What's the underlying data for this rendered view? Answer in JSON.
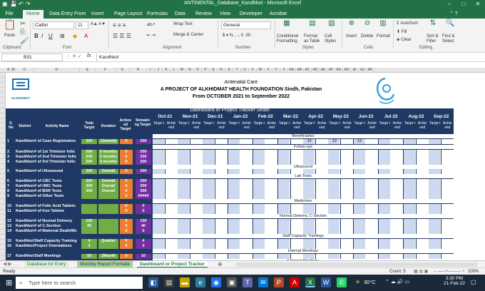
{
  "window": {
    "title": "ANTINENTAL_Database_Kandhkot  -  Microsoft Excel"
  },
  "tabs": [
    "File",
    "Home",
    "Data Entry From",
    "Insert",
    "Page Layout",
    "Formulas",
    "Data",
    "Review",
    "View",
    "Developer",
    "Acrobat"
  ],
  "ribbon": {
    "paste": "Paste",
    "font_name": "Calibri",
    "font_size": "11",
    "wrap_text": "Wrap Text",
    "merge_center": "Merge & Center",
    "number_format": "General",
    "conditional": "Conditional Formatting",
    "format_table": "Format as Table",
    "cell_styles": "Cell Styles",
    "insert": "Insert",
    "delete": "Delete",
    "format": "Format",
    "autosum": "AutoSum",
    "fill": "Fill",
    "clear": "Clear",
    "sort_filter": "Sort & Filter",
    "find_select": "Find & Select",
    "groups": {
      "clipboard": "Clipboard",
      "font": "Font",
      "alignment": "Alignment",
      "number": "Number",
      "styles": "Styles",
      "cells": "Cells",
      "editing": "Editing"
    }
  },
  "formula_bar": {
    "name_box": "B31",
    "fx": "fx",
    "content": "Kandhkot"
  },
  "columns": [
    "A",
    "B",
    "C",
    "D",
    "E",
    "F",
    "G",
    "H",
    "I",
    "J",
    "K",
    "L",
    "M",
    "N",
    "O",
    "P",
    "Q",
    "R",
    "S",
    "T",
    "U",
    "V",
    "W",
    "X",
    "Y",
    "Z",
    "AA",
    "AB",
    "AC",
    "AD",
    "AE",
    "AF",
    "AG",
    "AH",
    "AI",
    "AJ",
    "AK"
  ],
  "sheet": {
    "logo_text": "ALKHIDMAT",
    "title1": "Antenatal Care",
    "title2": "A PROJECT OF ALKHIDMAT HEALTH  FOUNDATION Sindh, Pakistan",
    "title3": "From OCTOBER 2021 to September 2022",
    "tracker": "Dashboard or Project Tracker Sindh",
    "col_headers": {
      "sno": "S. No",
      "district": "District",
      "activity": "Activity Name",
      "total": "Total Target",
      "duration": "Duration",
      "achieved": "Achiev ed Target",
      "remaining": "Remaini ng Target"
    },
    "months": [
      "Oct-21",
      "Nov-21",
      "Dec-21",
      "Jan-22",
      "Feb-22",
      "Mar-22",
      "Apr-22",
      "May-22",
      "Jun-22",
      "Jul-22",
      "Aug-22",
      "Sep-22"
    ],
    "sub_target": "Targe t",
    "sub_achieved": "Achie ved",
    "sections": {
      "beneficiaries": "Beneficiaries",
      "followups": "Follow ups",
      "ultrasound": "Ultrasound",
      "labtests": "Lab Tests",
      "medicines": "Medicines",
      "delivery": "Normal Delivery, C-Section",
      "trainings": "Staff Capacity Trainings",
      "internal": "Internal Meetings",
      "external": "External Meetings"
    },
    "rows": [
      {
        "sno": "1",
        "district": "Kandhkot",
        "activity": "# of Case Registration",
        "total": "300",
        "duration": "12month",
        "achieved": "0",
        "remaining": "300",
        "apr": "12",
        "may": "12",
        "jun": "12"
      },
      {
        "sno": "2",
        "district": "Kandhkot",
        "activity": "# of 1st Trimister follo",
        "total": "200",
        "duration": "3 months",
        "achieved": "0",
        "remaining": "200"
      },
      {
        "sno": "3",
        "district": "Kandhkot",
        "activity": "# of 2nd Trimister follo",
        "total": "200",
        "duration": "3 months",
        "achieved": "0",
        "remaining": "200"
      },
      {
        "sno": "4",
        "district": "Kandhkot",
        "activity": "# of 3rd Trimister follo",
        "total": "200",
        "duration": "3 months",
        "achieved": "0",
        "remaining": "200"
      },
      {
        "sno": "5",
        "district": "Kandhkot",
        "activity": "# of Ultrasound",
        "total": "300",
        "duration": "Overall",
        "achieved": "0",
        "remaining": "300"
      },
      {
        "sno": "6",
        "district": "Kandhkot",
        "activity": "# of CBC Tests",
        "total": "300",
        "duration": "Overall",
        "achieved": "0",
        "remaining": "300"
      },
      {
        "sno": "7",
        "district": "Kandhkot",
        "activity": "# of HBC Tests",
        "total": "300",
        "duration": "Overall",
        "achieved": "0",
        "remaining": "300"
      },
      {
        "sno": "8",
        "district": "Kandhkot",
        "activity": "# of BSR Tests",
        "total": "300",
        "duration": "Overall",
        "achieved": "0",
        "remaining": "300"
      },
      {
        "sno": "9",
        "district": "Kandhkot",
        "activity": "# of Other Tests",
        "total": "",
        "duration": "",
        "achieved": "0",
        "remaining": "#####"
      },
      {
        "sno": "10",
        "district": "Kandhkot",
        "activity": "# of Folic Acid Tablets",
        "total": "",
        "duration": "",
        "achieved": "0",
        "remaining": "0"
      },
      {
        "sno": "11",
        "district": "Kandhkot",
        "activity": "# of Iron Tablets",
        "total": "",
        "duration": "",
        "achieved": "0",
        "remaining": "0"
      },
      {
        "sno": "12",
        "district": "Kandhkot",
        "activity": "# of Normal Delivery",
        "total": "100",
        "duration": "",
        "achieved": "0",
        "remaining": "100"
      },
      {
        "sno": "13",
        "district": "Kandhkot",
        "activity": "# of C-Section",
        "total": "40",
        "duration": "",
        "achieved": "0",
        "remaining": "40"
      },
      {
        "sno": "14",
        "district": "Kandhkot",
        "activity": "# of Maternal Death/Mc",
        "total": "",
        "duration": "",
        "achieved": "0",
        "remaining": "0"
      },
      {
        "sno": "15",
        "district": "Kandhkot",
        "activity": "Staff Capacity Training",
        "total": "4",
        "duration": "Quarter",
        "achieved": "0",
        "remaining": "4"
      },
      {
        "sno": "16",
        "district": "Kandhkot",
        "activity": "Project Orientations",
        "total": "3",
        "duration": "",
        "achieved": "0",
        "remaining": "3"
      },
      {
        "sno": "17",
        "district": "Kandhkot",
        "activity": "Staff Meetings",
        "total": "10",
        "duration": "2Month",
        "achieved": "0",
        "remaining": "10"
      }
    ]
  },
  "sheet_tabs": [
    "Database for Entry",
    "Monthly Report Formate",
    "Dashboard or Project Tracker"
  ],
  "status": {
    "ready": "Ready",
    "count": "Count: 5",
    "zoom": "100%"
  },
  "taskbar": {
    "search": "Type here to search",
    "weather": "30°C",
    "time": "3:30 PM",
    "date": "21-Feb-22"
  },
  "colors": {
    "excel_green": "#217346",
    "navy": "#1f3864",
    "green_cell": "#70ad47",
    "orange_cell": "#ed7d31",
    "purple_cell": "#7030a0",
    "grid_blue": "#ccd9ee"
  }
}
